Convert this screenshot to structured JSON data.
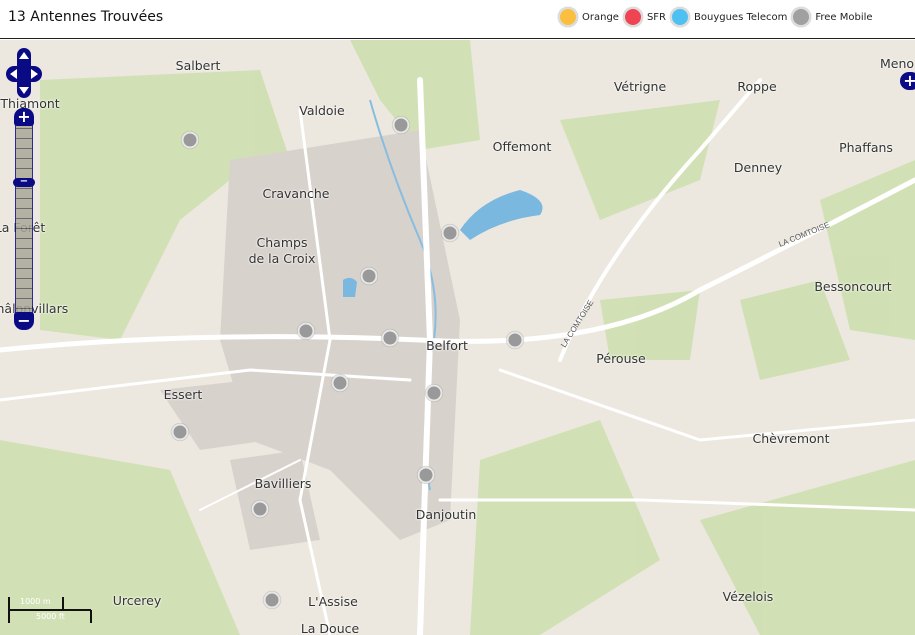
{
  "header": {
    "title": "13 Antennes Trouvées"
  },
  "legend": [
    {
      "label": "Orange",
      "color": "#fbbf3f"
    },
    {
      "label": "SFR",
      "color": "#ef4452"
    },
    {
      "label": "Bouygues Telecom",
      "color": "#4fc0f2"
    },
    {
      "label": "Free Mobile",
      "color": "#a0a0a0"
    }
  ],
  "map": {
    "places": [
      "Salbert",
      "Valdoie",
      "Thiamont",
      "Vétrigne",
      "Roppe",
      "Meno",
      "Offemont",
      "Phaffans",
      "Cravanche",
      "Denney",
      "Champs",
      "de la Croix",
      "La Forêt",
      "Bessoncourt",
      "Châlonvillars",
      "Belfort",
      "Pérouse",
      "Essert",
      "Chèvremont",
      "Bavilliers",
      "Danjoutin",
      "Urcerey",
      "L'Assise",
      "Vézelois",
      "La Douce"
    ],
    "roads": [
      "LA COMTOISE",
      "LA COMTOISE"
    ],
    "antenna_count": 13,
    "scale": {
      "metric": "1000 m",
      "imperial": "5000 ft"
    }
  }
}
